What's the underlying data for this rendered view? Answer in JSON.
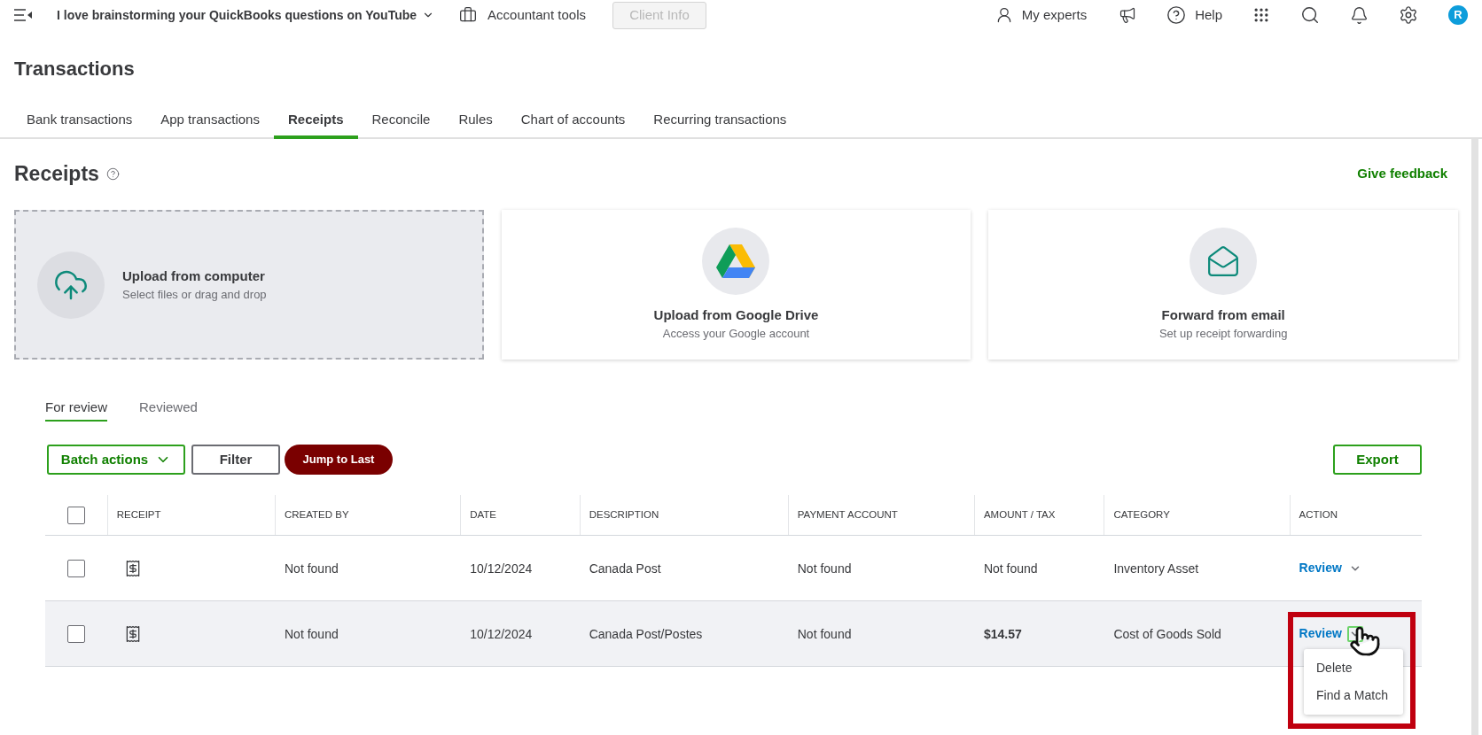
{
  "top_bar": {
    "company": "I love brainstorming your QuickBooks questions on YouTube",
    "accountant_tools": "Accountant tools",
    "client_info": {
      "label": "Client Info",
      "disabled": true
    },
    "my_experts": "My experts",
    "help": "Help",
    "avatar": "R"
  },
  "page_title": "Transactions",
  "tabs": [
    {
      "label": "Bank transactions",
      "selected": false
    },
    {
      "label": "App transactions",
      "selected": false
    },
    {
      "label": "Receipts",
      "selected": true
    },
    {
      "label": "Reconcile",
      "selected": false
    },
    {
      "label": "Rules",
      "selected": false
    },
    {
      "label": "Chart of accounts",
      "selected": false
    },
    {
      "label": "Recurring transactions",
      "selected": false
    }
  ],
  "section": {
    "title": "Receipts",
    "feedback": "Give feedback"
  },
  "upload_cards": [
    {
      "kind": "computer",
      "title": "Upload from computer",
      "subtitle": "Select files or drag and drop"
    },
    {
      "kind": "drive",
      "title": "Upload from Google Drive",
      "subtitle": "Access your Google account"
    },
    {
      "kind": "email",
      "title": "Forward from email",
      "subtitle": "Set up receipt forwarding"
    }
  ],
  "review_tabs": [
    {
      "label": "For review",
      "selected": true
    },
    {
      "label": "Reviewed",
      "selected": false
    }
  ],
  "toolbar": {
    "batch_actions": "Batch actions",
    "filter": "Filter",
    "jump": "Jump to Last",
    "export": "Export"
  },
  "table": {
    "header_checked": false,
    "columns": [
      "RECEIPT",
      "CREATED BY",
      "DATE",
      "DESCRIPTION",
      "PAYMENT ACCOUNT",
      "AMOUNT / TAX",
      "CATEGORY",
      "ACTION"
    ],
    "rows": [
      {
        "checked": false,
        "highlighted": false,
        "created_by": "Not found",
        "date": "10/12/2024",
        "description": "Canada Post",
        "payment_account": "Not found",
        "amount": "Not found",
        "amount_bold": false,
        "category": "Inventory Asset",
        "action": "Review",
        "chevron_focused": false
      },
      {
        "checked": false,
        "highlighted": true,
        "created_by": "Not found",
        "date": "10/12/2024",
        "description": "Canada Post/Postes",
        "payment_account": "Not found",
        "amount": "$14.57",
        "amount_bold": true,
        "category": "Cost of Goods Sold",
        "action": "Review",
        "chevron_focused": true
      }
    ]
  },
  "action_menu": {
    "items": [
      "Delete",
      "Find a Match"
    ]
  }
}
